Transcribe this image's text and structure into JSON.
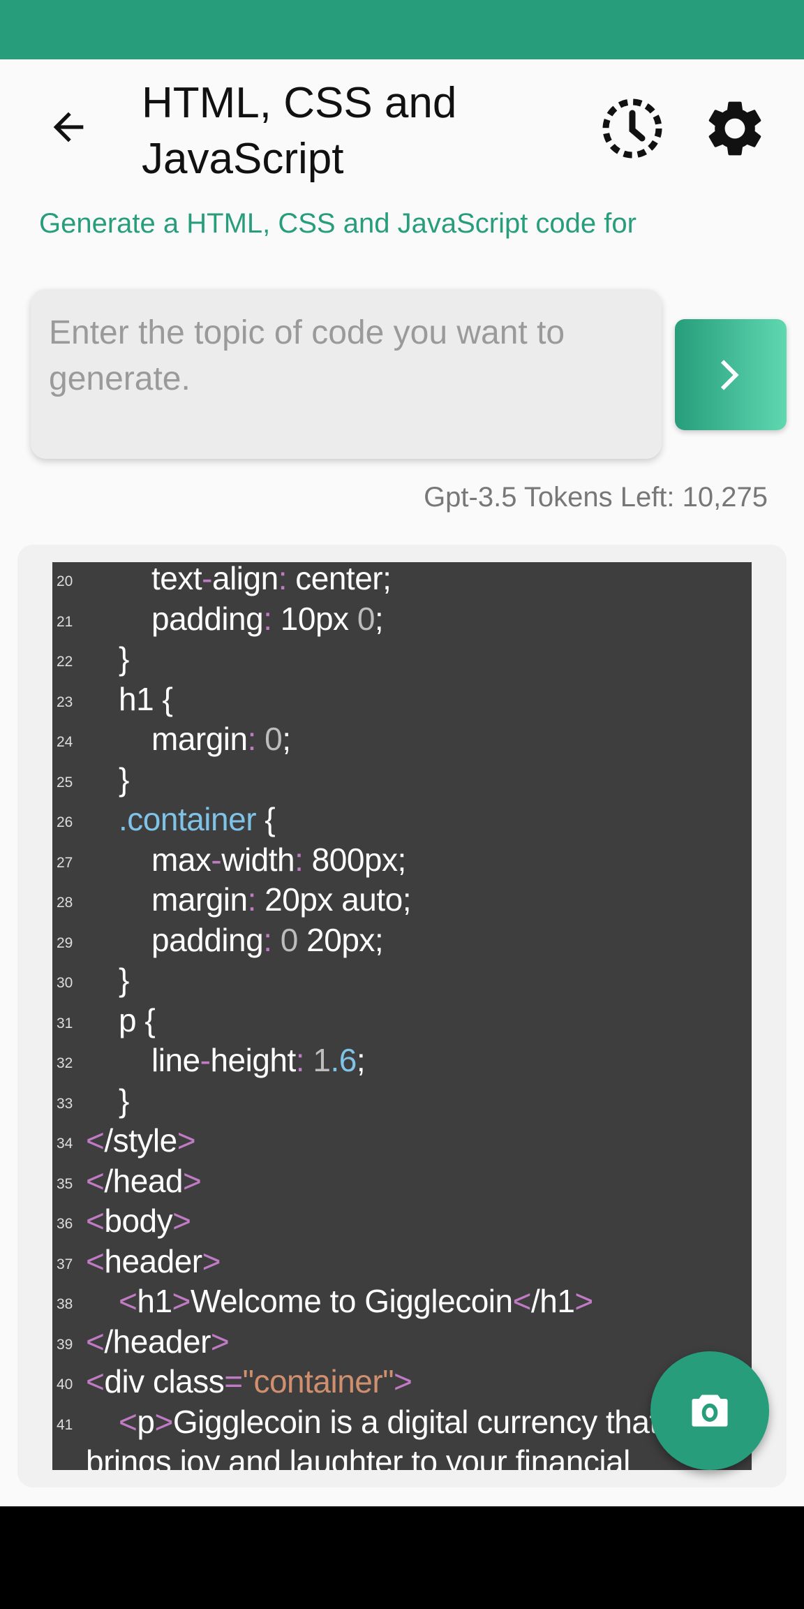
{
  "app": {
    "title": "HTML, CSS and JavaScript",
    "subtitle": "Generate a HTML, CSS and JavaScript code for",
    "input_placeholder": "Enter the topic of code you want to generate.",
    "input_value": "",
    "tokens_label": "Gpt-3.5 Tokens Left: 10,275",
    "accent_color": "#279d7b",
    "icons": {
      "back": "arrow-left-icon",
      "history": "history-icon",
      "settings": "gear-icon",
      "send": "chevron-right-icon",
      "fab": "camera-icon"
    }
  },
  "code": {
    "lines": [
      {
        "n": "20",
        "indent": 2,
        "tokens": [
          [
            "text",
            "plain"
          ],
          [
            "-",
            "punct"
          ],
          [
            "align",
            "plain"
          ],
          [
            ":",
            "punct"
          ],
          [
            " center;",
            "plain"
          ]
        ]
      },
      {
        "n": "21",
        "indent": 2,
        "tokens": [
          [
            "padding",
            "plain"
          ],
          [
            ":",
            "punct"
          ],
          [
            " 10px ",
            "plain"
          ],
          [
            "0",
            "num"
          ],
          [
            ";",
            "plain"
          ]
        ]
      },
      {
        "n": "22",
        "indent": 1,
        "tokens": [
          [
            "}",
            "plain"
          ]
        ]
      },
      {
        "n": "23",
        "indent": 1,
        "tokens": [
          [
            "h1 {",
            "plain"
          ]
        ]
      },
      {
        "n": "24",
        "indent": 2,
        "tokens": [
          [
            "margin",
            "plain"
          ],
          [
            ":",
            "punct"
          ],
          [
            " ",
            "plain"
          ],
          [
            "0",
            "num"
          ],
          [
            ";",
            "plain"
          ]
        ]
      },
      {
        "n": "25",
        "indent": 1,
        "tokens": [
          [
            "}",
            "plain"
          ]
        ]
      },
      {
        "n": "26",
        "indent": 1,
        "tokens": [
          [
            ".container",
            "class"
          ],
          [
            " {",
            "plain"
          ]
        ]
      },
      {
        "n": "27",
        "indent": 2,
        "tokens": [
          [
            "max",
            "plain"
          ],
          [
            "-",
            "punct"
          ],
          [
            "width",
            "plain"
          ],
          [
            ":",
            "punct"
          ],
          [
            " 800px;",
            "plain"
          ]
        ]
      },
      {
        "n": "28",
        "indent": 2,
        "tokens": [
          [
            "margin",
            "plain"
          ],
          [
            ":",
            "punct"
          ],
          [
            " 20px auto;",
            "plain"
          ]
        ]
      },
      {
        "n": "29",
        "indent": 2,
        "tokens": [
          [
            "padding",
            "plain"
          ],
          [
            ":",
            "punct"
          ],
          [
            " ",
            "plain"
          ],
          [
            "0",
            "num"
          ],
          [
            " 20px;",
            "plain"
          ]
        ]
      },
      {
        "n": "30",
        "indent": 1,
        "tokens": [
          [
            "}",
            "plain"
          ]
        ]
      },
      {
        "n": "31",
        "indent": 1,
        "tokens": [
          [
            "p {",
            "plain"
          ]
        ]
      },
      {
        "n": "32",
        "indent": 2,
        "tokens": [
          [
            "line",
            "plain"
          ],
          [
            "-",
            "punct"
          ],
          [
            "height",
            "plain"
          ],
          [
            ":",
            "punct"
          ],
          [
            " 1",
            "num"
          ],
          [
            ".6",
            "numblue"
          ],
          [
            ";",
            "plain"
          ]
        ]
      },
      {
        "n": "33",
        "indent": 1,
        "tokens": [
          [
            "}",
            "plain"
          ]
        ]
      },
      {
        "n": "34",
        "indent": 0,
        "tokens": [
          [
            "<",
            "punct"
          ],
          [
            "/style",
            "plain"
          ],
          [
            ">",
            "punct"
          ]
        ]
      },
      {
        "n": "35",
        "indent": 0,
        "tokens": [
          [
            "<",
            "punct"
          ],
          [
            "/head",
            "plain"
          ],
          [
            ">",
            "punct"
          ]
        ]
      },
      {
        "n": "36",
        "indent": 0,
        "tokens": [
          [
            "<",
            "punct"
          ],
          [
            "body",
            "plain"
          ],
          [
            ">",
            "punct"
          ]
        ]
      },
      {
        "n": "37",
        "indent": 0,
        "tokens": [
          [
            "<",
            "punct"
          ],
          [
            "header",
            "plain"
          ],
          [
            ">",
            "punct"
          ]
        ]
      },
      {
        "n": "38",
        "indent": 1,
        "tokens": [
          [
            "<",
            "punct"
          ],
          [
            "h1",
            "plain"
          ],
          [
            ">",
            "punct"
          ],
          [
            "Welcome to Gigglecoin",
            "plain"
          ],
          [
            "<",
            "punct"
          ],
          [
            "/h1",
            "plain"
          ],
          [
            ">",
            "punct"
          ]
        ]
      },
      {
        "n": "39",
        "indent": 0,
        "tokens": [
          [
            "<",
            "punct"
          ],
          [
            "/header",
            "plain"
          ],
          [
            ">",
            "punct"
          ]
        ]
      },
      {
        "n": "40",
        "indent": 0,
        "tokens": [
          [
            "<",
            "punct"
          ],
          [
            "div class",
            "plain"
          ],
          [
            "=",
            "punct"
          ],
          [
            "\"container\"",
            "str"
          ],
          [
            ">",
            "punct"
          ]
        ]
      },
      {
        "n": "41",
        "indent": 1,
        "tokens": [
          [
            "<",
            "punct"
          ],
          [
            "p",
            "plain"
          ],
          [
            ">",
            "punct"
          ],
          [
            "Gigglecoin is a digital currency that brings joy and laughter to your financial",
            "plain"
          ]
        ]
      }
    ]
  }
}
